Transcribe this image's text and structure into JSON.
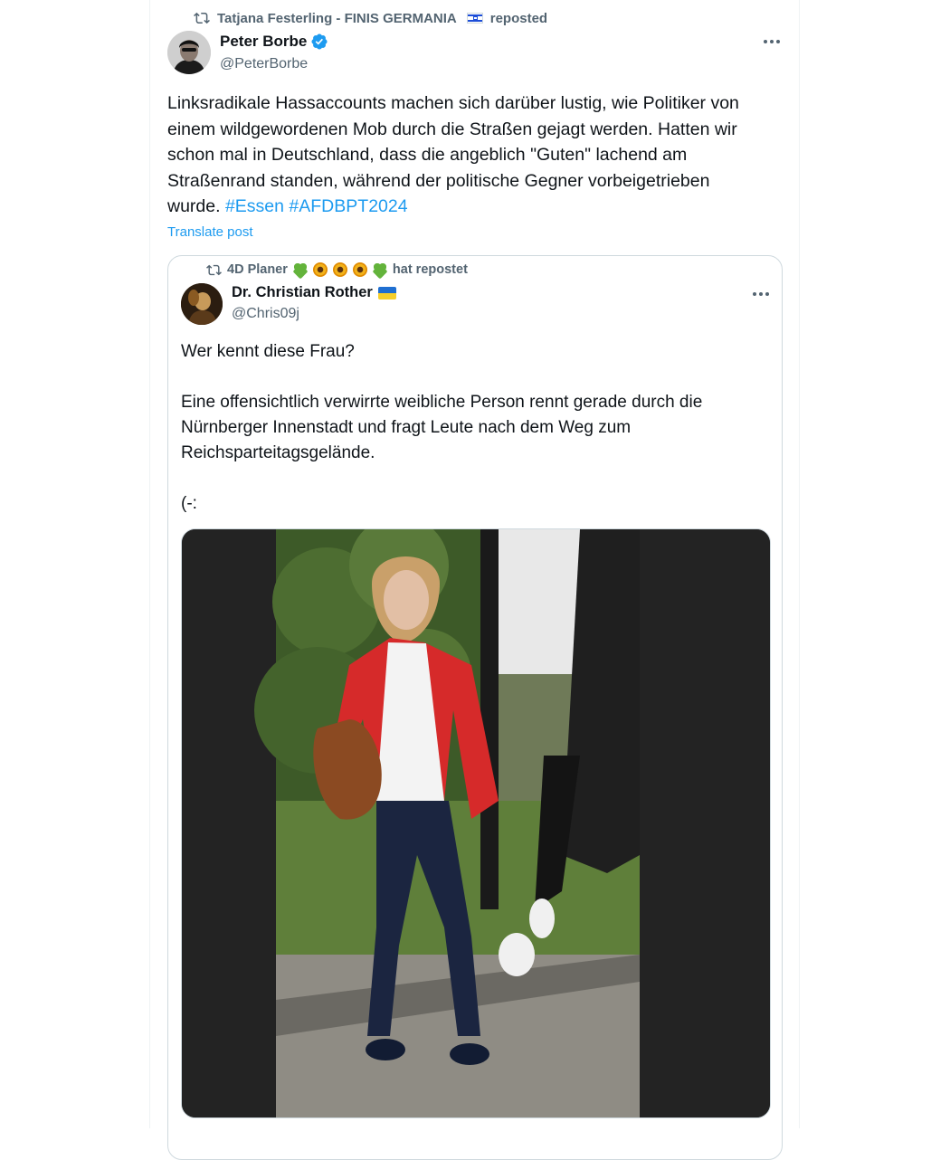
{
  "repost": {
    "reposter_name": "Tatjana Festerling - FINIS GERMANIA",
    "label": "reposted",
    "icon": "repost-icon"
  },
  "post": {
    "author_name": "Peter Borbe",
    "author_handle": "@PeterBorbe",
    "verified": true,
    "text": "Linksradikale Hassaccounts machen sich darüber lustig, wie Politiker von einem wildgewordenen Mob durch die Straßen gejagt werden. Hatten wir schon mal in Deutschland, dass die angeblich \"Guten\" lachend am Straßenrand standen, während der politische Gegner vorbeigetrieben wurde.",
    "hashtags": [
      "#Essen",
      "#AFDBPT2024"
    ],
    "translate_label": "Translate post"
  },
  "quote": {
    "repost_name": "4D Planer",
    "repost_label": "hat repostet",
    "author_name": "Dr. Christian Rother",
    "author_handle": "@Chris09j",
    "text": "Wer kennt diese Frau?\n\nEine offensichtlich verwirrte weibliche Person rennt gerade durch die Nürnberger Innenstadt und fragt Leute nach dem Weg zum Reichsparteitagsgelände.\n\n(-:"
  },
  "colors": {
    "accent": "#1d9bf0",
    "text": "#0f1419",
    "secondary": "#536471",
    "border": "#cfd9de"
  }
}
